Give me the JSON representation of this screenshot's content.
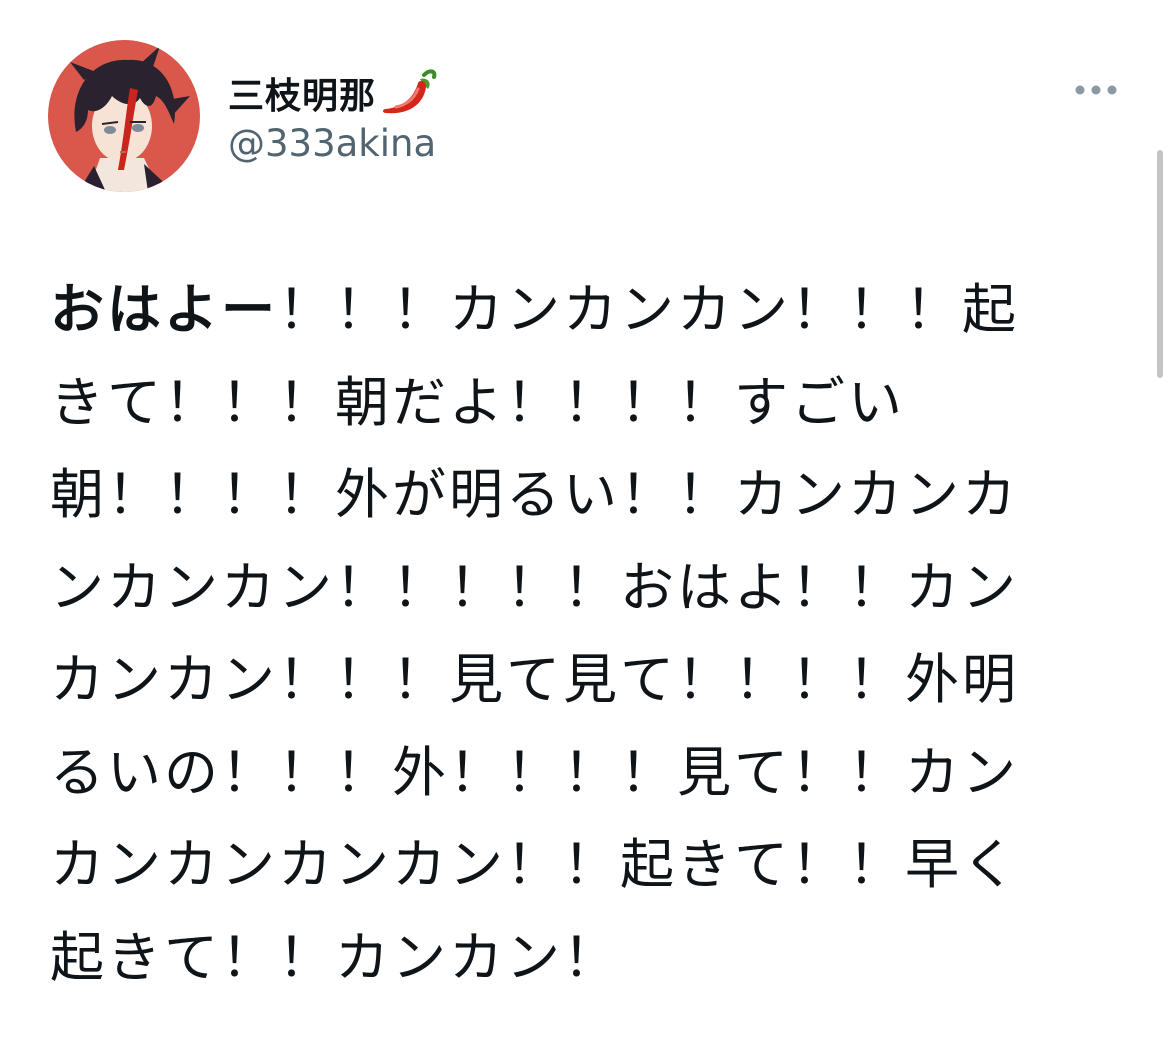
{
  "author": {
    "display_name": "三枝明那",
    "name_emoji": "hot-pepper-icon",
    "handle": "@333akina"
  },
  "more_menu": {
    "icon": "more-horizontal-icon"
  },
  "tweet": {
    "lead_bold": "おはよー",
    "lines": [
      "！！！カンカンカン！！！起",
      "きて！！！朝だよ！！！！すごい",
      "朝！！！！外が明るい！！カンカンカ",
      "ンカンカン！！！！！おはよ！！カン",
      "カンカン！！！見て見て！！！！外明",
      "るいの！！！外！！！！見て！！カン",
      "カンカンカンカン！！起きて！！早く",
      "起きて！！カンカン！"
    ]
  },
  "colors": {
    "text": "#0f1419",
    "secondary": "#536471",
    "avatar_bg": "#d9574b"
  }
}
